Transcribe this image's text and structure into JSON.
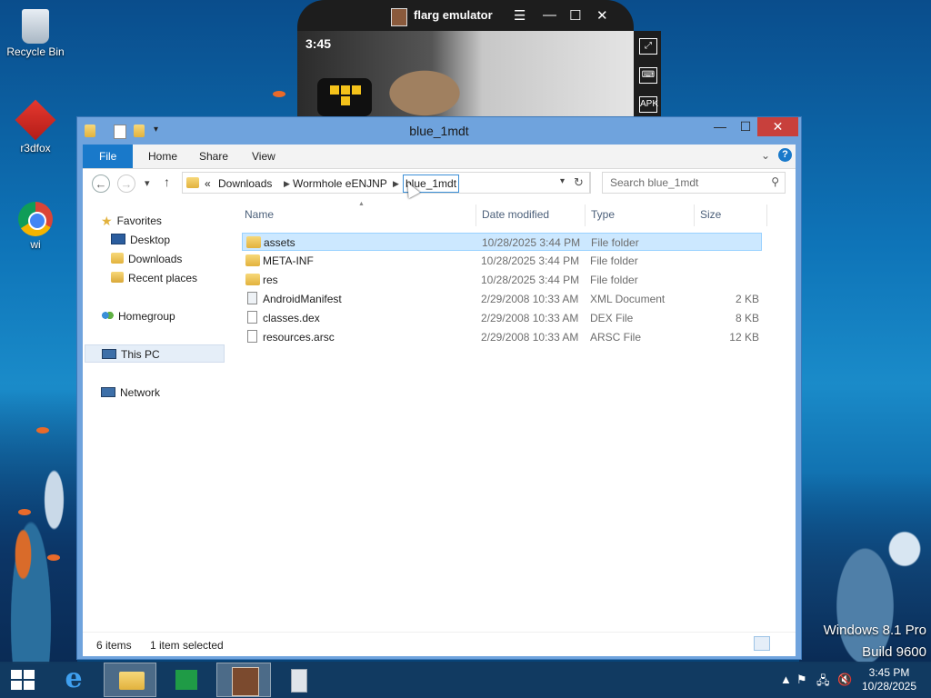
{
  "desktop": {
    "icons": [
      {
        "label": "Recycle Bin"
      },
      {
        "label": "r3dfox"
      },
      {
        "label": "wi"
      }
    ],
    "watermark": {
      "line1": "Windows 8.1 Pro",
      "line2": "Build 9600"
    }
  },
  "emulator": {
    "title": "flarg emulator",
    "status_time": "3:45",
    "controls": {
      "menu": "☰",
      "minimize": "—",
      "maximize": "☐",
      "close": "✕"
    },
    "side_buttons": [
      "fullscreen-icon",
      "keyboard-icon",
      "apk-icon"
    ],
    "apk_label": "APK"
  },
  "explorer": {
    "title": "blue_1mdt",
    "ribbon_tabs": [
      "File",
      "Home",
      "Share",
      "View"
    ],
    "address": {
      "overflow": "«",
      "crumbs": [
        "Downloads",
        "Wormhole eENJNP",
        "blue_1mdt"
      ]
    },
    "search": {
      "placeholder": "Search blue_1mdt"
    },
    "nav_pane": {
      "favorites": "Favorites",
      "favorite_items": [
        "Desktop",
        "Downloads",
        "Recent places"
      ],
      "homegroup": "Homegroup",
      "this_pc": "This PC",
      "network": "Network"
    },
    "columns": {
      "name": "Name",
      "date": "Date modified",
      "type": "Type",
      "size": "Size"
    },
    "files": [
      {
        "name": "assets",
        "date": "10/28/2025 3:44 PM",
        "type": "File folder",
        "size": "",
        "icon": "folder-icon",
        "selected": true
      },
      {
        "name": "META-INF",
        "date": "10/28/2025 3:44 PM",
        "type": "File folder",
        "size": "",
        "icon": "folder-icon"
      },
      {
        "name": "res",
        "date": "10/28/2025 3:44 PM",
        "type": "File folder",
        "size": "",
        "icon": "folder-icon"
      },
      {
        "name": "AndroidManifest",
        "date": "2/29/2008 10:33 AM",
        "type": "XML Document",
        "size": "2 KB",
        "icon": "xml-file-icon"
      },
      {
        "name": "classes.dex",
        "date": "2/29/2008 10:33 AM",
        "type": "DEX File",
        "size": "8 KB",
        "icon": "file-icon"
      },
      {
        "name": "resources.arsc",
        "date": "2/29/2008 10:33 AM",
        "type": "ARSC File",
        "size": "12 KB",
        "icon": "file-icon"
      }
    ],
    "status": {
      "items": "6 items",
      "selected": "1 item selected"
    }
  },
  "taskbar": {
    "clock": {
      "time": "3:45 PM",
      "date": "10/28/2025"
    },
    "apps": [
      "start-icon",
      "internet-explorer-icon",
      "file-explorer-icon",
      "store-icon",
      "flarg-emulator-icon",
      "app-icon"
    ]
  }
}
